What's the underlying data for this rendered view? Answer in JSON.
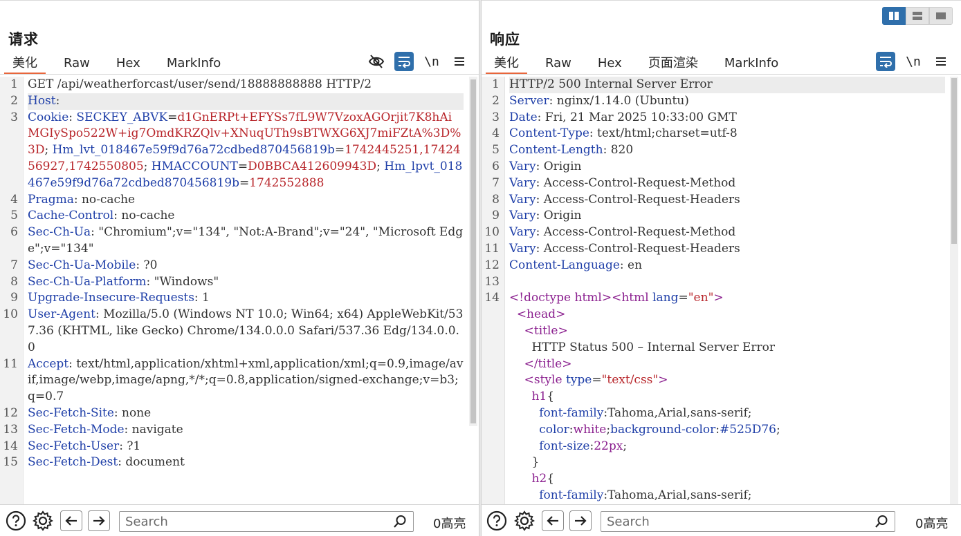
{
  "request": {
    "title": "请求",
    "tabs": [
      "美化",
      "Raw",
      "Hex",
      "MarkInfo"
    ],
    "active_tab": "美化",
    "newline_label": "\\n",
    "search_placeholder": "Search",
    "hits": "0高亮",
    "lines": [
      {
        "n": "1",
        "spans": [
          {
            "c": "v",
            "t": "GET /api/weatherforcast/user/send/18888888888 HTTP/2"
          }
        ]
      },
      {
        "n": "2",
        "hl": true,
        "spans": [
          {
            "c": "k",
            "t": "Host"
          },
          {
            "c": "v",
            "t": ":"
          }
        ]
      },
      {
        "n": "3",
        "spans": [
          {
            "c": "k",
            "t": "Cookie"
          },
          {
            "c": "v",
            "t": ": "
          },
          {
            "c": "k",
            "t": "SECKEY_ABVK"
          },
          {
            "c": "v",
            "t": "="
          },
          {
            "c": "r",
            "t": "d1GnERPt+EFYSs7fL9W7VzoxAGOrjit7K8hAiMGIySpo522W+ig7OmdKRZQlv+XNuqUTh9sBTWXG6XJ7miFZtA%3D%3D"
          },
          {
            "c": "v",
            "t": "; "
          },
          {
            "c": "k",
            "t": "Hm_lvt_018467e59f9d76a72cdbed870456819b"
          },
          {
            "c": "v",
            "t": "="
          },
          {
            "c": "r",
            "t": "1742445251,1742456927,1742550805"
          },
          {
            "c": "v",
            "t": "; "
          },
          {
            "c": "k",
            "t": "HMACCOUNT"
          },
          {
            "c": "v",
            "t": "="
          },
          {
            "c": "r",
            "t": "D0BBCA412609943D"
          },
          {
            "c": "v",
            "t": "; "
          },
          {
            "c": "k",
            "t": "Hm_lpvt_018467e59f9d76a72cdbed870456819b"
          },
          {
            "c": "v",
            "t": "="
          },
          {
            "c": "r",
            "t": "1742552888"
          }
        ]
      },
      {
        "n": "4",
        "spans": [
          {
            "c": "k",
            "t": "Pragma"
          },
          {
            "c": "v",
            "t": ": no-cache"
          }
        ]
      },
      {
        "n": "5",
        "spans": [
          {
            "c": "k",
            "t": "Cache-Control"
          },
          {
            "c": "v",
            "t": ": no-cache"
          }
        ]
      },
      {
        "n": "6",
        "spans": [
          {
            "c": "k",
            "t": "Sec-Ch-Ua"
          },
          {
            "c": "v",
            "t": ": \"Chromium\";v=\"134\", \"Not:A-Brand\";v=\"24\", \"Microsoft Edge\";v=\"134\""
          }
        ]
      },
      {
        "n": "7",
        "spans": [
          {
            "c": "k",
            "t": "Sec-Ch-Ua-Mobile"
          },
          {
            "c": "v",
            "t": ": ?0"
          }
        ]
      },
      {
        "n": "8",
        "spans": [
          {
            "c": "k",
            "t": "Sec-Ch-Ua-Platform"
          },
          {
            "c": "v",
            "t": ": \"Windows\""
          }
        ]
      },
      {
        "n": "9",
        "spans": [
          {
            "c": "k",
            "t": "Upgrade-Insecure-Requests"
          },
          {
            "c": "v",
            "t": ": 1"
          }
        ]
      },
      {
        "n": "10",
        "spans": [
          {
            "c": "k",
            "t": "User-Agent"
          },
          {
            "c": "v",
            "t": ": Mozilla/5.0 (Windows NT 10.0; Win64; x64) AppleWebKit/537.36 (KHTML, like Gecko) Chrome/134.0.0.0 Safari/537.36 Edg/134.0.0.0"
          }
        ]
      },
      {
        "n": "11",
        "spans": [
          {
            "c": "k",
            "t": "Accept"
          },
          {
            "c": "v",
            "t": ": text/html,application/xhtml+xml,application/xml;q=0.9,image/avif,image/webp,image/apng,*/*;q=0.8,application/signed-exchange;v=b3;q=0.7"
          }
        ]
      },
      {
        "n": "12",
        "spans": [
          {
            "c": "k",
            "t": "Sec-Fetch-Site"
          },
          {
            "c": "v",
            "t": ": none"
          }
        ]
      },
      {
        "n": "13",
        "spans": [
          {
            "c": "k",
            "t": "Sec-Fetch-Mode"
          },
          {
            "c": "v",
            "t": ": navigate"
          }
        ]
      },
      {
        "n": "14",
        "spans": [
          {
            "c": "k",
            "t": "Sec-Fetch-User"
          },
          {
            "c": "v",
            "t": ": ?1"
          }
        ]
      },
      {
        "n": "15",
        "spans": [
          {
            "c": "k",
            "t": "Sec-Fetch-Dest"
          },
          {
            "c": "v",
            "t": ": document"
          }
        ]
      }
    ]
  },
  "response": {
    "title": "响应",
    "tabs": [
      "美化",
      "Raw",
      "Hex",
      "页面渲染",
      "MarkInfo"
    ],
    "active_tab": "美化",
    "newline_label": "\\n",
    "search_placeholder": "Search",
    "hits": "0高亮",
    "lines": [
      {
        "n": "1",
        "hl": true,
        "spans": [
          {
            "c": "v",
            "t": "HTTP/2 500 Internal Server Error"
          }
        ]
      },
      {
        "n": "2",
        "spans": [
          {
            "c": "k",
            "t": "Server"
          },
          {
            "c": "v",
            "t": ": nginx/1.14.0 (Ubuntu)"
          }
        ]
      },
      {
        "n": "3",
        "spans": [
          {
            "c": "k",
            "t": "Date"
          },
          {
            "c": "v",
            "t": ": Fri, 21 Mar 2025 10:33:00 GMT"
          }
        ]
      },
      {
        "n": "4",
        "spans": [
          {
            "c": "k",
            "t": "Content-Type"
          },
          {
            "c": "v",
            "t": ": text/html;charset=utf-8"
          }
        ]
      },
      {
        "n": "5",
        "spans": [
          {
            "c": "k",
            "t": "Content-Length"
          },
          {
            "c": "v",
            "t": ": 820"
          }
        ]
      },
      {
        "n": "6",
        "spans": [
          {
            "c": "k",
            "t": "Vary"
          },
          {
            "c": "v",
            "t": ": Origin"
          }
        ]
      },
      {
        "n": "7",
        "spans": [
          {
            "c": "k",
            "t": "Vary"
          },
          {
            "c": "v",
            "t": ": Access-Control-Request-Method"
          }
        ]
      },
      {
        "n": "8",
        "spans": [
          {
            "c": "k",
            "t": "Vary"
          },
          {
            "c": "v",
            "t": ": Access-Control-Request-Headers"
          }
        ]
      },
      {
        "n": "9",
        "spans": [
          {
            "c": "k",
            "t": "Vary"
          },
          {
            "c": "v",
            "t": ": Origin"
          }
        ]
      },
      {
        "n": "10",
        "spans": [
          {
            "c": "k",
            "t": "Vary"
          },
          {
            "c": "v",
            "t": ": Access-Control-Request-Method"
          }
        ]
      },
      {
        "n": "11",
        "spans": [
          {
            "c": "k",
            "t": "Vary"
          },
          {
            "c": "v",
            "t": ": Access-Control-Request-Headers"
          }
        ]
      },
      {
        "n": "12",
        "spans": [
          {
            "c": "k",
            "t": "Content-Language"
          },
          {
            "c": "v",
            "t": ": en"
          }
        ]
      },
      {
        "n": "13",
        "spans": [
          {
            "c": "v",
            "t": " "
          }
        ]
      },
      {
        "n": "14",
        "spans": [
          {
            "c": "t",
            "t": "<!doctype html><html "
          },
          {
            "c": "a",
            "t": "lang"
          },
          {
            "c": "v",
            "t": "="
          },
          {
            "c": "s",
            "t": "\"en\""
          },
          {
            "c": "t",
            "t": ">"
          }
        ]
      },
      {
        "n": "",
        "spans": [
          {
            "c": "v",
            "t": "  "
          },
          {
            "c": "t",
            "t": "<head>"
          }
        ]
      },
      {
        "n": "",
        "spans": [
          {
            "c": "v",
            "t": "    "
          },
          {
            "c": "t",
            "t": "<title>"
          }
        ]
      },
      {
        "n": "",
        "spans": [
          {
            "c": "v",
            "t": "      HTTP Status 500 – Internal Server Error"
          }
        ]
      },
      {
        "n": "",
        "spans": [
          {
            "c": "v",
            "t": "    "
          },
          {
            "c": "t",
            "t": "</title>"
          }
        ]
      },
      {
        "n": "",
        "spans": [
          {
            "c": "v",
            "t": "    "
          },
          {
            "c": "t",
            "t": "<style "
          },
          {
            "c": "a",
            "t": "type"
          },
          {
            "c": "v",
            "t": "="
          },
          {
            "c": "s",
            "t": "\"text/css\""
          },
          {
            "c": "t",
            "t": ">"
          }
        ]
      },
      {
        "n": "",
        "spans": [
          {
            "c": "v",
            "t": "      "
          },
          {
            "c": "t",
            "t": "h1"
          },
          {
            "c": "v",
            "t": "{"
          }
        ]
      },
      {
        "n": "",
        "spans": [
          {
            "c": "v",
            "t": "        "
          },
          {
            "c": "a",
            "t": "font-family"
          },
          {
            "c": "v",
            "t": ":Tahoma,Arial,sans-serif;"
          }
        ]
      },
      {
        "n": "",
        "spans": [
          {
            "c": "v",
            "t": "        "
          },
          {
            "c": "a",
            "t": "color"
          },
          {
            "c": "v",
            "t": ":"
          },
          {
            "c": "t",
            "t": "white"
          },
          {
            "c": "v",
            "t": ";"
          },
          {
            "c": "a",
            "t": "background-color"
          },
          {
            "c": "v",
            "t": ":"
          },
          {
            "c": "n",
            "t": "#525D76"
          },
          {
            "c": "v",
            "t": ";"
          }
        ]
      },
      {
        "n": "",
        "spans": [
          {
            "c": "v",
            "t": "        "
          },
          {
            "c": "a",
            "t": "font-size"
          },
          {
            "c": "v",
            "t": ":"
          },
          {
            "c": "t",
            "t": "22px"
          },
          {
            "c": "v",
            "t": ";"
          }
        ]
      },
      {
        "n": "",
        "spans": [
          {
            "c": "v",
            "t": "      }"
          }
        ]
      },
      {
        "n": "",
        "spans": [
          {
            "c": "v",
            "t": "      "
          },
          {
            "c": "t",
            "t": "h2"
          },
          {
            "c": "v",
            "t": "{"
          }
        ]
      },
      {
        "n": "",
        "spans": [
          {
            "c": "v",
            "t": "        "
          },
          {
            "c": "a",
            "t": "font-family"
          },
          {
            "c": "v",
            "t": ":Tahoma,Arial,sans-serif;"
          }
        ]
      }
    ]
  },
  "colors": {
    "accent": "#2f6fab",
    "active_tab_underline": "#e8663c"
  },
  "icons": [
    "eye-off-icon",
    "wrap-icon",
    "menu-icon",
    "help-icon",
    "gear-icon",
    "arrow-left-icon",
    "arrow-right-icon",
    "search-icon",
    "layout-columns-icon",
    "layout-rows-icon",
    "layout-single-icon"
  ]
}
